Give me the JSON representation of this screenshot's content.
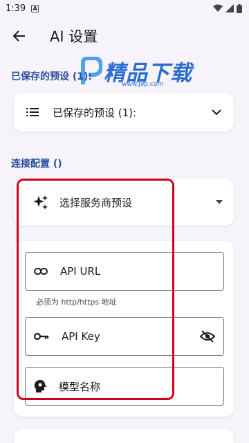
{
  "status_bar": {
    "time": "1:39",
    "badge": "A"
  },
  "app_bar": {
    "title": "AI 设置"
  },
  "watermark": {
    "text": "精品下载",
    "url": "www.j9p.com"
  },
  "saved_presets": {
    "section_title": "已保存的预设 (1):",
    "dropdown_label": "已保存的预设 (1):"
  },
  "connection": {
    "section_title": "连接配置 ()",
    "provider_label": "选择服务商预设",
    "api_url_label": "API URL",
    "api_url_helper": "必须为 http/https 地址",
    "api_key_label": "API Key",
    "model_label": "模型名称"
  },
  "colors": {
    "accent": "#2a4f9a",
    "highlight": "#d0021b",
    "background": "#f7f3fa"
  }
}
